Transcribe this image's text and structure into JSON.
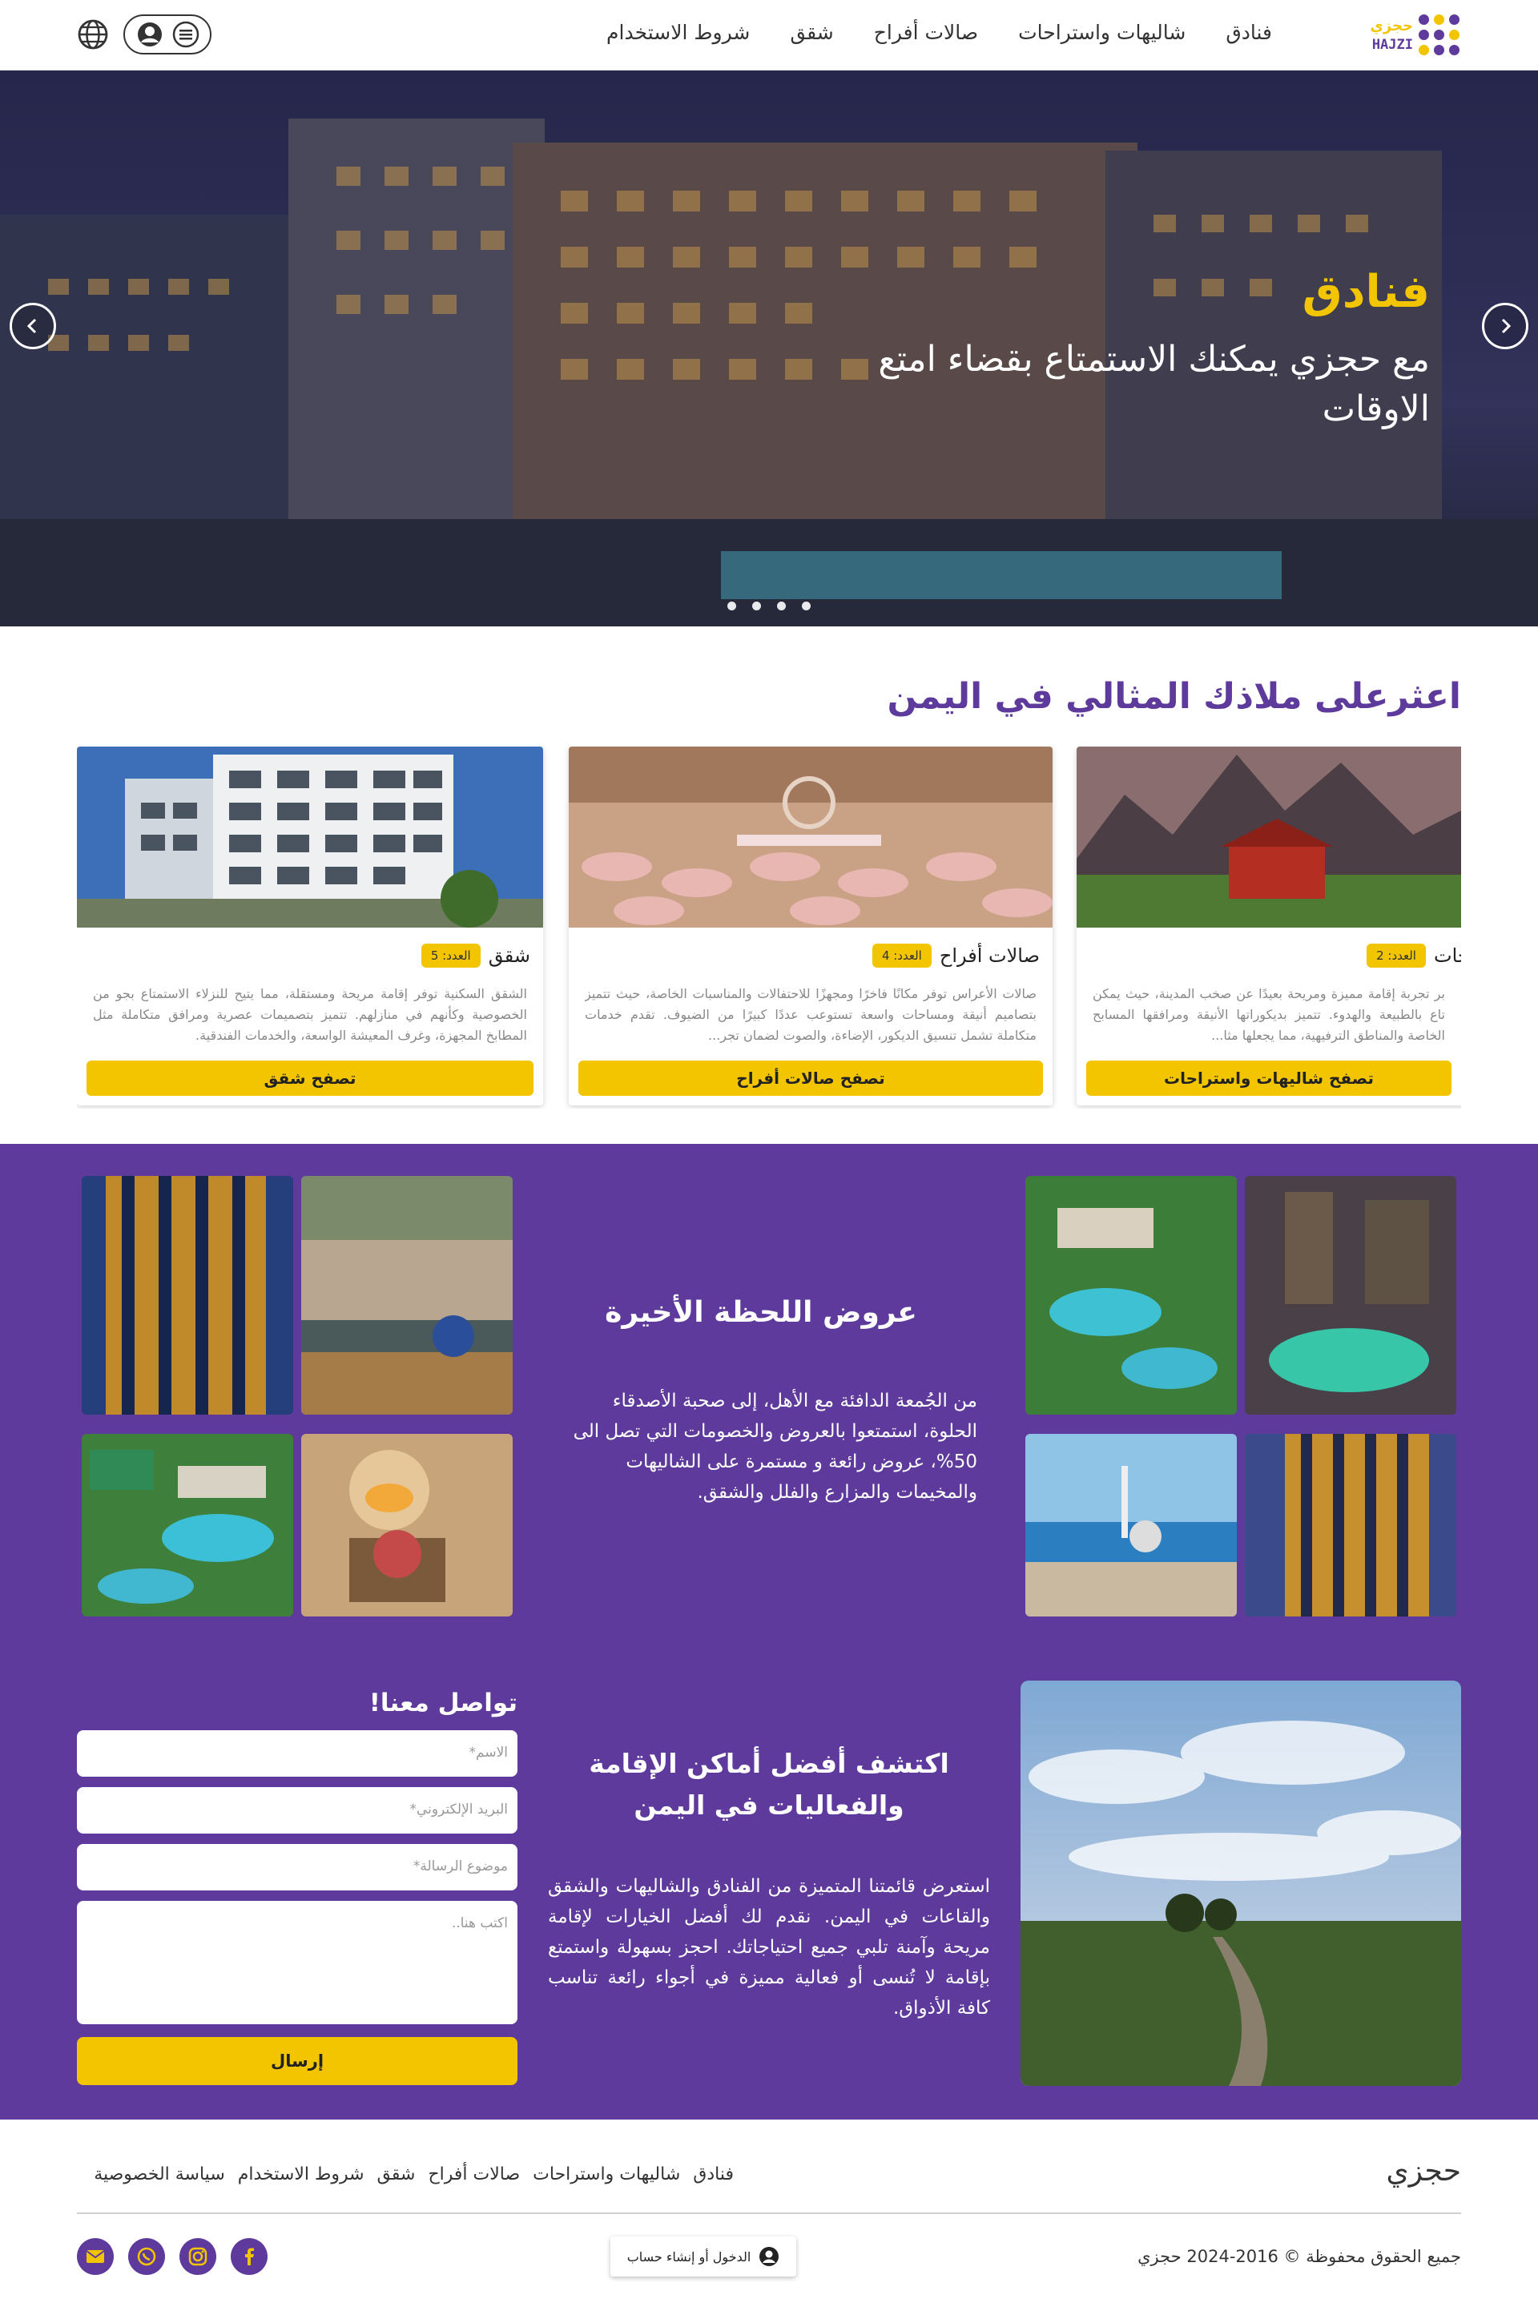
{
  "brand": {
    "name_ar": "حجزي",
    "name_en": "HAJZI"
  },
  "nav": [
    "فنادق",
    "شاليهات واستراحات",
    "صالات أفراح",
    "شقق",
    "شروط الاستخدام"
  ],
  "hero": {
    "title": "فنادق",
    "text": "مع حجزي يمكنك الاستمتاع بقضاء امتع الاوقات",
    "slides": 4
  },
  "categories": {
    "title": "اعثرعلى ملاذك المثالي في اليمن",
    "items": [
      {
        "name": "ستراحات",
        "badge": "العدد: 2",
        "desc": "بر تجربة إقامة مميزة ومريحة بعيدًا عن صخب المدينة، حيث يمكن تاع بالطبيعة والهدوء. تتميز بديكوراتها الأنيقة ومرافقها المسابح الخاصة والمناطق الترفيهية، مما يجعلها مثا...",
        "button": "تصفح شاليهات واستراحات"
      },
      {
        "name": "صالات أفراح",
        "badge": "العدد: 4",
        "desc": "صالات الأعراس توفر مكانًا فاخرًا ومجهزًا للاحتفالات والمناسبات الخاصة، حيث تتميز بتصاميم أنيقة ومساحات واسعة تستوعب عددًا كبيرًا من الضيوف. تقدم خدمات متكاملة تشمل تنسيق الديكور، الإضاءة، والصوت لضمان تجر...",
        "button": "تصفح صالات أفراح"
      },
      {
        "name": "شقق",
        "badge": "العدد: 5",
        "desc": "الشقق السكنية توفر إقامة مريحة ومستقلة، مما يتيح للنزلاء الاستمتاع بجو من الخصوصية وكأنهم في منازلهم. تتميز بتصميمات عصرية ومرافق متكاملة مثل المطابخ المجهزة، وغرف المعيشة الواسعة، والخدمات الفندقية.",
        "button": "تصفح شقق"
      }
    ]
  },
  "offers": {
    "title": "عروض اللحظة الأخيرة",
    "text": "من الجُمعة الدافئة مع الأهل، إلى صحبة الأصدقاء الحلوة، استمتعوا بالعروض والخصومات التي تصل الى 50%، عروض رائعة و مستمرة على الشاليهات والمخيمات والمزارع والفلل والشقق."
  },
  "discover": {
    "title": "اكتشف أفضل أماكن الإقامة والفعاليات في اليمن",
    "text": "استعرض قائمتنا المتميزة من الفنادق والشاليهات والشقق والقاعات في اليمن. نقدم لك أفضل الخيارات لإقامة مريحة وآمنة تلبي جميع احتياجاتك. احجز بسهولة واستمتع بإقامة لا تُنسى أو فعالية مميزة في أجواء رائعة تناسب كافة الأذواق."
  },
  "contact": {
    "title": "تواصل معنا!",
    "name_placeholder": "الاسم*",
    "email_placeholder": "البريد الإلكتروني*",
    "subject_placeholder": "موضوع الرسالة*",
    "message_placeholder": "اكتب هنا..",
    "send": "إرسال"
  },
  "footer": {
    "brand": "حجزي",
    "links": [
      "فنادق",
      "شاليهات واستراحات",
      "صالات أفراح",
      "شقق",
      "شروط الاستخدام",
      "سياسة الخصوصية"
    ],
    "copyright": "جميع الحقوق محفوظة © 2016-2024 حجزي",
    "login": "الدخول أو إنشاء حساب"
  },
  "colors": {
    "primary": "#5d3a9b",
    "accent": "#f2c500"
  }
}
